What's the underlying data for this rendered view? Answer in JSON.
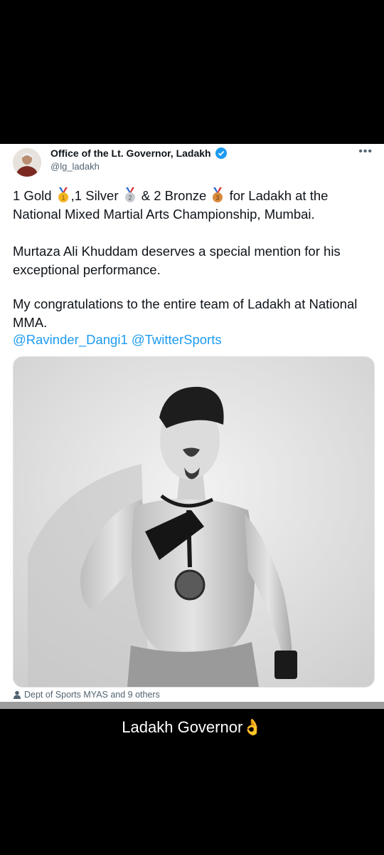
{
  "tweet": {
    "author_name": "Office of the Lt. Governor, Ladakh",
    "handle": "@lg_ladakh",
    "more_icon": "more-horizontal-icon",
    "verified_color": "#1d9bf0",
    "line1_a": "1 Gold",
    "line1_b": ",1 Silver",
    "line1_c": "& 2 Bronze",
    "line1_d": "for Ladakh at the",
    "line2": "National Mixed Martial Arts Championship, Mumbai.",
    "para2": "Murtaza Ali Khuddam deserves a special mention for his exceptional performance.",
    "para3": "My congratulations to the entire team of Ladakh at National MMA.",
    "mention1": "@Ravinder_Dangi1",
    "mention2": "@TwitterSports",
    "medals": [
      "1",
      "2",
      "3"
    ],
    "likes_text": "Dept of Sports MYAS and 9 others"
  },
  "caption": "Ladakh Governor👌"
}
